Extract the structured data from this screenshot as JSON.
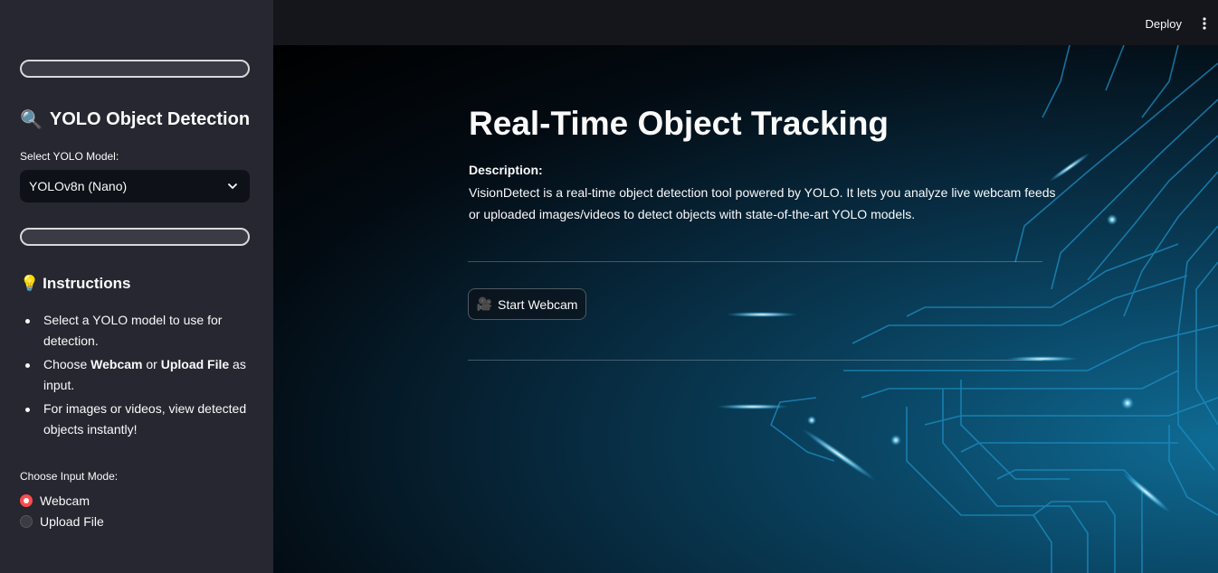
{
  "header": {
    "deploy_label": "Deploy",
    "menu_icon": "more-vertical-icon"
  },
  "sidebar": {
    "title_icon": "🔍",
    "title": "YOLO Object Detection",
    "model_label": "Select YOLO Model:",
    "model_selected": "YOLOv8n (Nano)",
    "instructions_icon": "💡",
    "instructions_title": "Instructions",
    "instructions": [
      {
        "pre": "Select a YOLO model to use for detection.",
        "b1": "",
        "mid": "",
        "b2": "",
        "post": ""
      },
      {
        "pre": "Choose ",
        "b1": "Webcam",
        "mid": " or ",
        "b2": "Upload File",
        "post": " as input."
      },
      {
        "pre": "For images or videos, view detected objects instantly!",
        "b1": "",
        "mid": "",
        "b2": "",
        "post": ""
      }
    ],
    "input_mode_label": "Choose Input Mode:",
    "input_modes": [
      {
        "label": "Webcam",
        "selected": true
      },
      {
        "label": "Upload File",
        "selected": false
      }
    ]
  },
  "main": {
    "title": "Real-Time Object Tracking",
    "description_label": "Description:",
    "description": "VisionDetect is a real-time object detection tool powered by YOLO. It lets you analyze live webcam feeds or uploaded images/videos to detect objects with state-of-the-art YOLO models.",
    "start_button_icon": "🎥",
    "start_button_label": "Start Webcam"
  },
  "colors": {
    "sidebar_bg": "#262730",
    "accent": "#ff4b4b",
    "main_bg": "#0e1117"
  }
}
